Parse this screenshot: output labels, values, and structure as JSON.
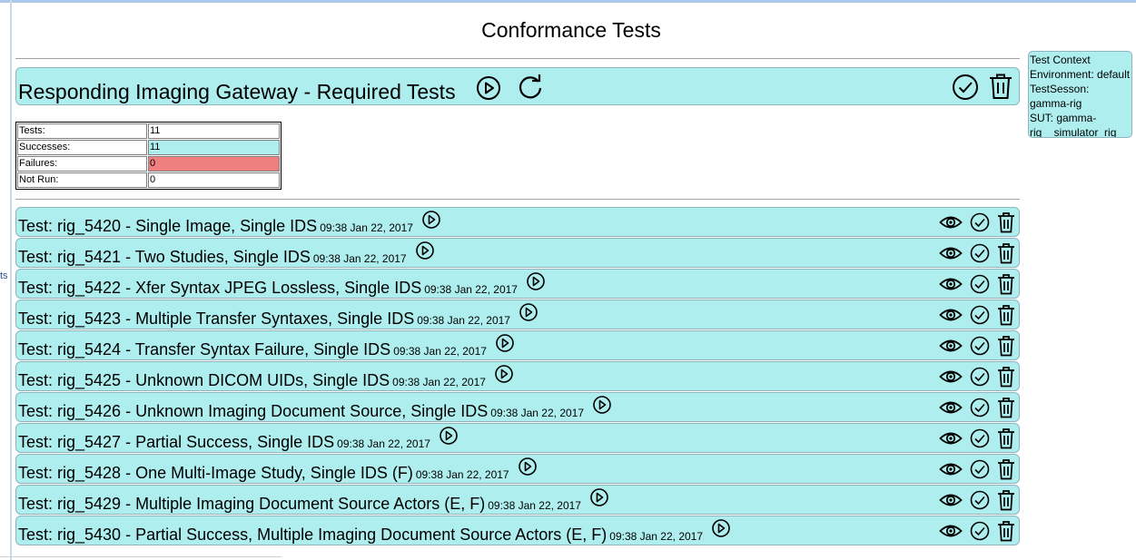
{
  "page": {
    "title": "Conformance Tests"
  },
  "actor": {
    "title": "Responding Imaging Gateway - Required Tests"
  },
  "context": {
    "heading": "Test Context",
    "environment": "Environment: default",
    "session": "TestSesson: gamma-rig",
    "sut": "SUT: gamma-rig__simulator_rig"
  },
  "stats": {
    "tests_label": "Tests:",
    "tests_value": "11",
    "successes_label": "Successes:",
    "successes_value": "11",
    "failures_label": "Failures:",
    "failures_value": "0",
    "notrun_label": "Not Run:",
    "notrun_value": "0"
  },
  "left_fragment": "ts",
  "tests": [
    {
      "name": "Test: rig_5420 - Single Image, Single IDS",
      "time": "09:38 Jan 22, 2017"
    },
    {
      "name": "Test: rig_5421 - Two Studies, Single IDS",
      "time": "09:38 Jan 22, 2017"
    },
    {
      "name": "Test: rig_5422 - Xfer Syntax JPEG Lossless, Single IDS",
      "time": "09:38 Jan 22, 2017"
    },
    {
      "name": "Test: rig_5423 - Multiple Transfer Syntaxes, Single IDS",
      "time": "09:38 Jan 22, 2017"
    },
    {
      "name": "Test: rig_5424 - Transfer Syntax Failure, Single IDS",
      "time": "09:38 Jan 22, 2017"
    },
    {
      "name": "Test: rig_5425 - Unknown DICOM UIDs, Single IDS",
      "time": "09:38 Jan 22, 2017"
    },
    {
      "name": "Test: rig_5426 - Unknown Imaging Document Source, Single IDS",
      "time": "09:38 Jan 22, 2017"
    },
    {
      "name": "Test: rig_5427 - Partial Success, Single IDS",
      "time": "09:38 Jan 22, 2017"
    },
    {
      "name": "Test: rig_5428 - One Multi-Image Study, Single IDS (F)",
      "time": "09:38 Jan 22, 2017"
    },
    {
      "name": "Test: rig_5429 - Multiple Imaging Document Source Actors (E, F)",
      "time": "09:38 Jan 22, 2017"
    },
    {
      "name": "Test: rig_5430 - Partial Success, Multiple Imaging Document Source Actors (E, F)",
      "time": "09:38 Jan 22, 2017"
    }
  ],
  "colors": {
    "row_bg": "#afeeee",
    "failure_bg": "#f08080"
  }
}
